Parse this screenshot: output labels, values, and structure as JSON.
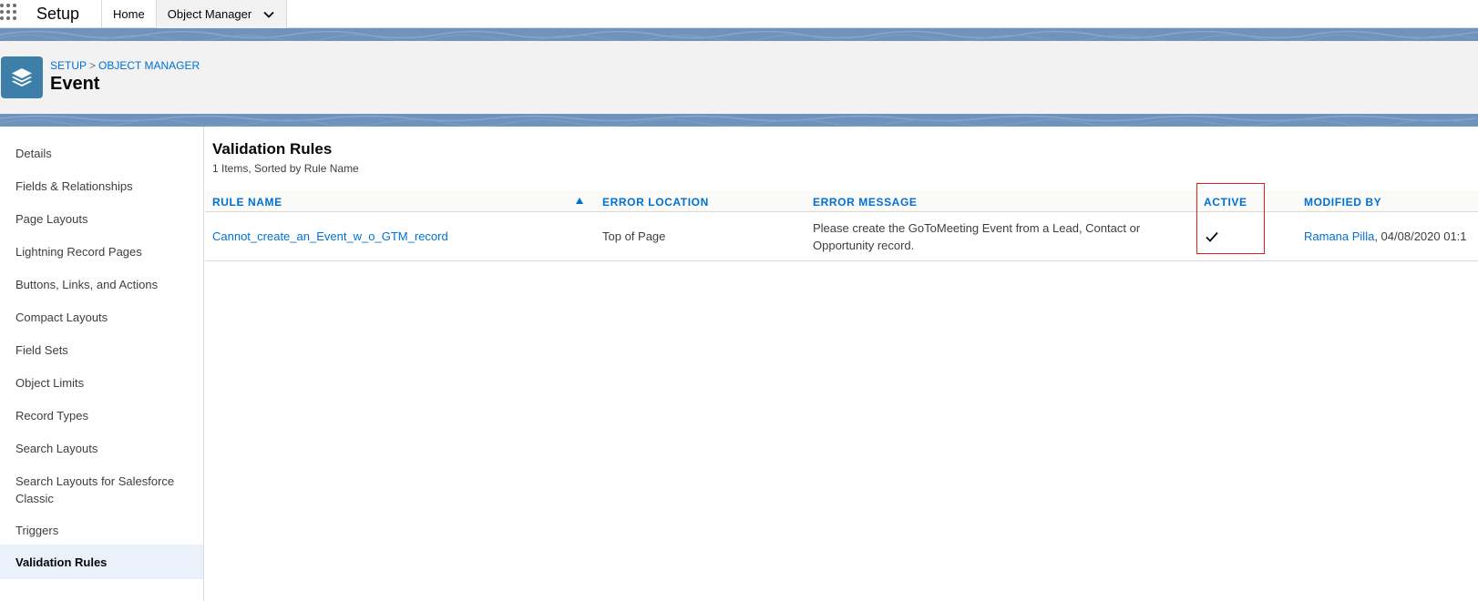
{
  "topbar": {
    "app_name": "Setup",
    "tabs": [
      {
        "label": "Home"
      },
      {
        "label": "Object Manager"
      }
    ]
  },
  "header": {
    "breadcrumb": [
      "SETUP",
      "OBJECT MANAGER"
    ],
    "breadcrumb_separator": ">",
    "title": "Event",
    "icon": "layers-icon"
  },
  "sidebar": {
    "items": [
      {
        "label": "Details"
      },
      {
        "label": "Fields & Relationships"
      },
      {
        "label": "Page Layouts"
      },
      {
        "label": "Lightning Record Pages"
      },
      {
        "label": "Buttons, Links, and Actions"
      },
      {
        "label": "Compact Layouts"
      },
      {
        "label": "Field Sets"
      },
      {
        "label": "Object Limits"
      },
      {
        "label": "Record Types"
      },
      {
        "label": "Search Layouts"
      },
      {
        "label": "Search Layouts for Salesforce Classic"
      },
      {
        "label": "Triggers"
      },
      {
        "label": "Validation Rules",
        "active": true
      }
    ]
  },
  "main": {
    "title": "Validation Rules",
    "subtitle": "1 Items, Sorted by Rule Name",
    "columns": [
      "RULE NAME",
      "ERROR LOCATION",
      "ERROR MESSAGE",
      "ACTIVE",
      "MODIFIED BY"
    ],
    "rows": [
      {
        "rule_name": "Cannot_create_an_Event_w_o_GTM_record",
        "error_location": "Top of Page",
        "error_message": "Please create the GoToMeeting Event from a Lead, Contact or Opportunity record.",
        "active": true,
        "modified_by_user": "Ramana Pilla",
        "modified_by_date": ", 04/08/2020 01:1"
      }
    ]
  },
  "colors": {
    "brand_link": "#0070d2",
    "banner": "#6f93bd",
    "icon_bg": "#3d7fa8",
    "highlight_box": "#e02020",
    "active_nav_bg": "#eaf1fb"
  }
}
